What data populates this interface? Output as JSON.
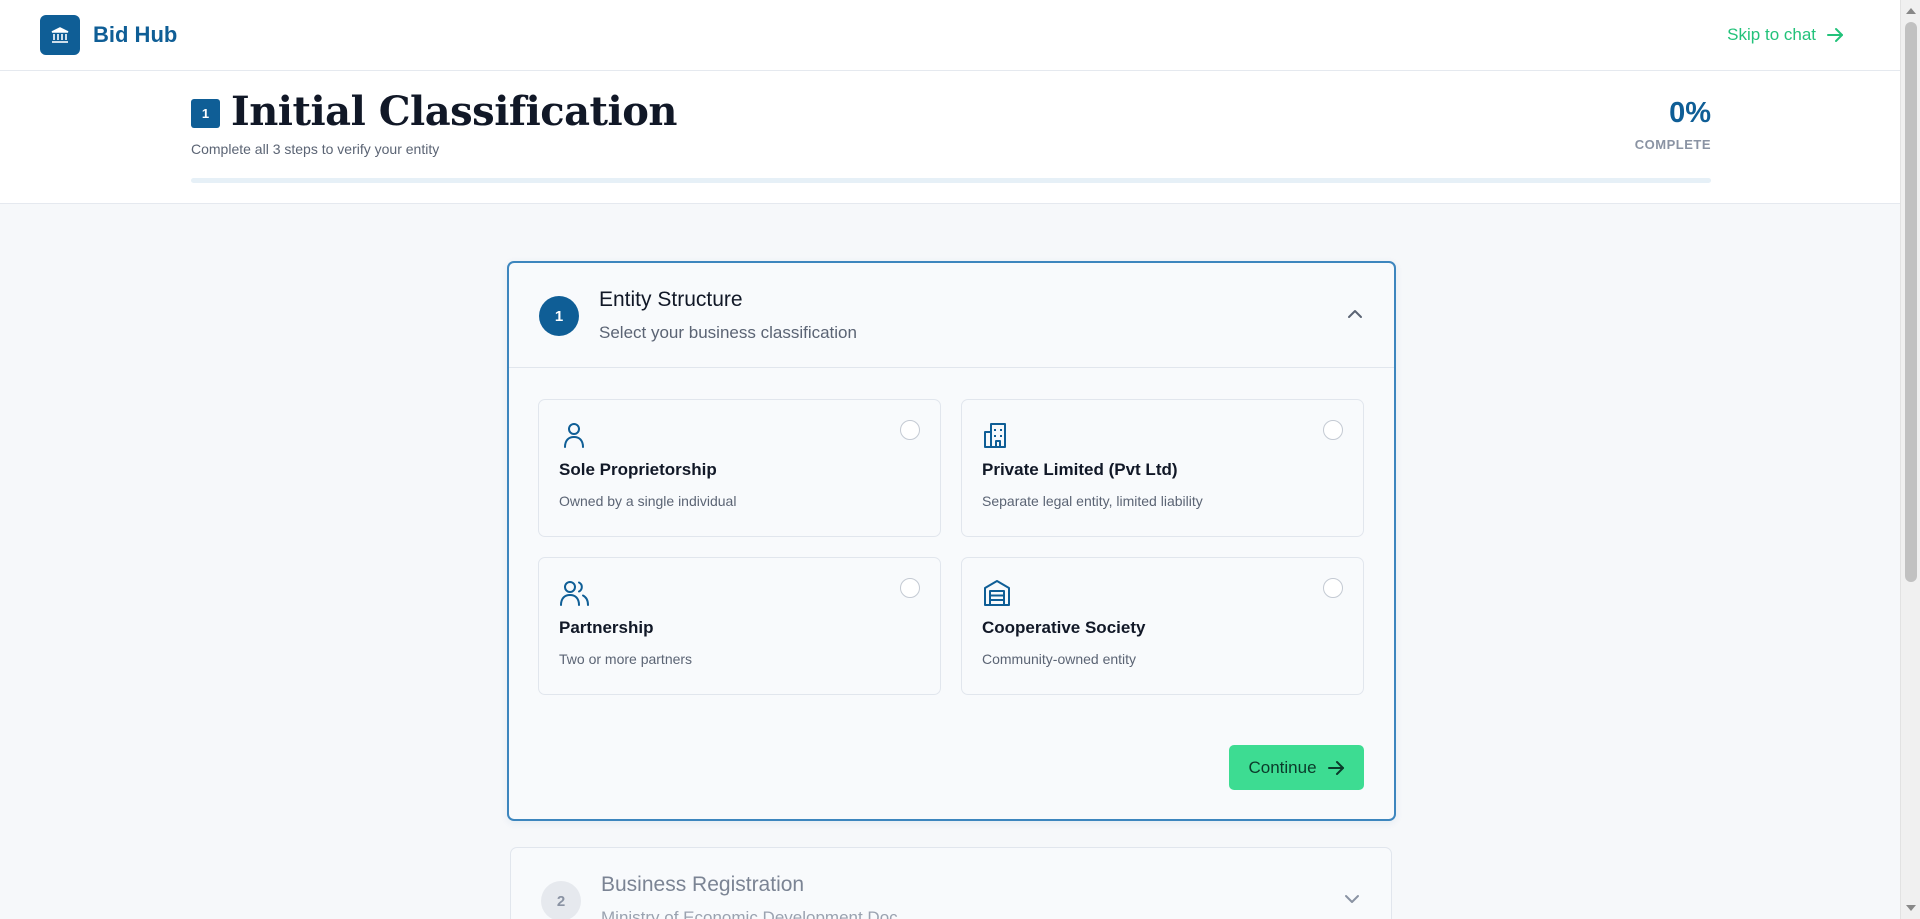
{
  "nav": {
    "brand": "Bid Hub",
    "skip_label": "Skip to chat"
  },
  "header": {
    "step_number": "1",
    "title": "Initial Classification",
    "subtitle": "Complete all 3 steps to verify your entity",
    "percent": "0%",
    "percent_label": "COMPLETE",
    "progress": 0
  },
  "step1": {
    "number": "1",
    "title": "Entity Structure",
    "subtitle": "Select your business classification",
    "options": [
      {
        "icon": "user-icon",
        "title": "Sole Proprietorship",
        "desc": "Owned by a single individual"
      },
      {
        "icon": "building-icon",
        "title": "Private Limited (Pvt Ltd)",
        "desc": "Separate legal entity, limited liability"
      },
      {
        "icon": "users-icon",
        "title": "Partnership",
        "desc": "Two or more partners"
      },
      {
        "icon": "warehouse-icon",
        "title": "Cooperative Society",
        "desc": "Community-owned entity"
      }
    ],
    "continue_label": "Continue"
  },
  "step2": {
    "number": "2",
    "title": "Business Registration",
    "subtitle": "Ministry of Economic Development Doc"
  },
  "colors": {
    "primary": "#0f5e96",
    "accent": "#3ddc92",
    "link": "#22c27a"
  }
}
